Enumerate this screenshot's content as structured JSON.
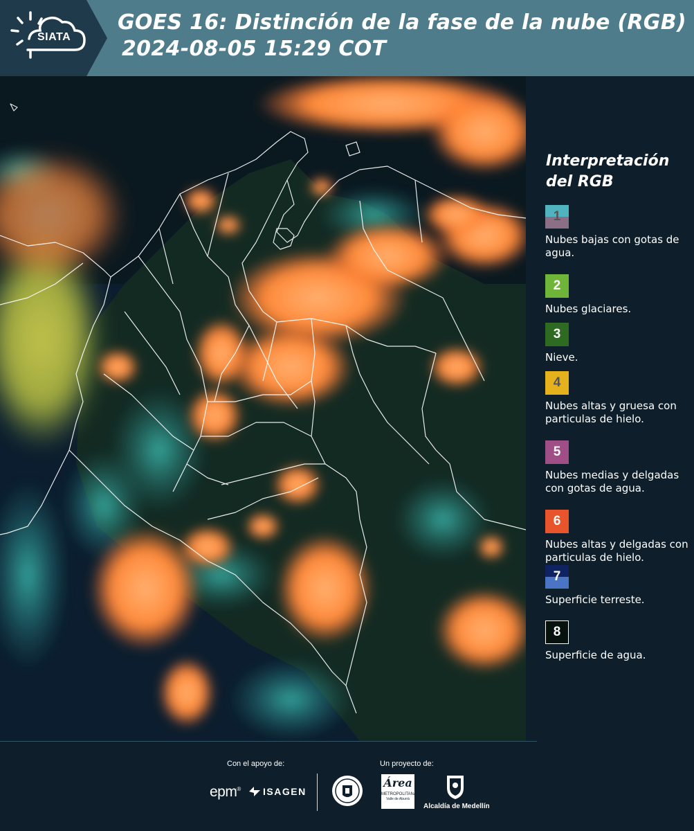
{
  "header": {
    "logo_text": "SIATA",
    "title_line1": "GOES 16: Distinción de la fase de la nube (RGB)",
    "title_line2": "2024-08-05 15:29 COT"
  },
  "map": {
    "description_colors": {
      "ocean": "#0b1d2e",
      "cloud_high": "#ff8a3a",
      "cloud_low": "#2fbfb6",
      "border": "#ffffff"
    }
  },
  "legend": {
    "title": "Interpretación del RGB",
    "items": [
      {
        "num": "1",
        "label": "Nubes bajas con gotas de agua.",
        "color_top": "#4fb3c0",
        "color_bottom": "#8a6f86",
        "num_color": "#555555"
      },
      {
        "num": "2",
        "label": "Nubes glaciares.",
        "color_top": "#6fb53a",
        "color_bottom": "#6fb53a",
        "num_color": "#ffffff"
      },
      {
        "num": "3",
        "label": "Nieve.",
        "color_top": "#2f6a22",
        "color_bottom": "#2f6a22",
        "num_color": "#ffffff"
      },
      {
        "num": "4",
        "label": "Nubes altas y gruesa con particulas de hielo.",
        "color_top": "#e5b21e",
        "color_bottom": "#e5b21e",
        "num_color": "#555555"
      },
      {
        "num": "5",
        "label": "Nubes medias y delgadas con gotas de agua.",
        "color_top": "#a04e86",
        "color_bottom": "#a04e86",
        "num_color": "#ffffff"
      },
      {
        "num": "6",
        "label": "Nubes altas y delgadas con particulas de hielo.",
        "color_top": "#e8542c",
        "color_bottom": "#e8542c",
        "num_color": "#ffffff"
      },
      {
        "num": "7",
        "label": "Superficie terreste.",
        "color_top": "#0f2362",
        "color_bottom": "#4a74c4",
        "num_color": "#ffffff"
      },
      {
        "num": "8",
        "label": "Superficie de agua.",
        "color_top": "#07120e",
        "color_bottom": "#07120e",
        "num_color": "#ffffff"
      }
    ]
  },
  "footer": {
    "support_label": "Con el apoyo de:",
    "project_label": "Un proyecto de:",
    "sponsor_epm": "epm",
    "sponsor_isagen": "ISAGEN",
    "area_logo_text": "Área",
    "area_logo_sub": "METROPOLITANA",
    "area_logo_sub2": "Valle de Aburrá",
    "alcaldia_text": "Alcaldía de Medellín"
  }
}
